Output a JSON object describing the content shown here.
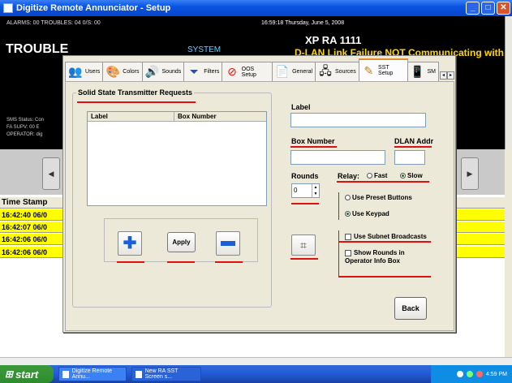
{
  "window": {
    "title": "Digitize Remote Annunciator - Setup",
    "btn_min": "_",
    "btn_max": "□",
    "btn_close": "✕"
  },
  "announcer": {
    "status": "ALARMS: 00  TROUBLES: 04  0/S: 00",
    "timestamp": "16:59:18 Thursday, June 5, 2008",
    "state": "TROUBLE",
    "system_label": "SYSTEM",
    "device": "XP RA 1111",
    "message": "D-LAN Link Failure NOT Communicating with",
    "sms_status": "SMS Status: Con",
    "fa_supv": "FA SUPV: 00  E",
    "operator": "OPERATOR: dig"
  },
  "nav": {
    "left_arrow": "◀",
    "right_arrow": "▶"
  },
  "events": {
    "header": "Time Stamp",
    "rows": [
      "16:42:40 06/0",
      "16:42:07 06/0",
      "16:42:06 06/0",
      "16:42:06 06/0"
    ]
  },
  "tabs": [
    {
      "label": "Users",
      "icon": "users-icon",
      "glyph": "👥"
    },
    {
      "label": "Colors",
      "icon": "palette-icon",
      "glyph": "🎨"
    },
    {
      "label": "Sounds",
      "icon": "speaker-icon",
      "glyph": "🔊"
    },
    {
      "label": "Filters",
      "icon": "filter-icon",
      "glyph": "⏷"
    },
    {
      "label": "OOS Setup",
      "icon": "no-entry-icon",
      "glyph": "⊘"
    },
    {
      "label": "General",
      "icon": "document-icon",
      "glyph": "📄"
    },
    {
      "label": "Sources",
      "icon": "network-icon",
      "glyph": "🖧"
    },
    {
      "label": "SST Setup",
      "icon": "sst-icon",
      "glyph": "✎"
    },
    {
      "label": "SM",
      "icon": "phone-icon",
      "glyph": "📱"
    }
  ],
  "form": {
    "group_title": "Solid State Transmitter Requests",
    "list_col_label": "Label",
    "list_col_box": "Box Number",
    "apply_label": "Apply",
    "label_field_label": "Label",
    "label_value": "",
    "box_number_label": "Box Number",
    "box_number_value": "",
    "dlan_label": "DLAN Addr",
    "dlan_value": "",
    "rounds_label": "Rounds",
    "rounds_value": "0",
    "relay_label": "Relay:",
    "relay_fast": "Fast",
    "relay_slow": "Slow",
    "use_preset": "Use Preset Buttons",
    "use_keypad": "Use Keypad",
    "use_subnet": "Use Subnet Broadcasts",
    "show_rounds": "Show Rounds in Operator Info Box",
    "back_label": "Back"
  },
  "taskbar": {
    "start": "start",
    "tasks": [
      "Digitize Remote Annu...",
      "New RA SST Screen s..."
    ],
    "clock": "4:59 PM"
  },
  "colors": {
    "accent_underline": "#dd1111",
    "event_row": "#ffff00",
    "title_bar": "#0a54e3"
  }
}
